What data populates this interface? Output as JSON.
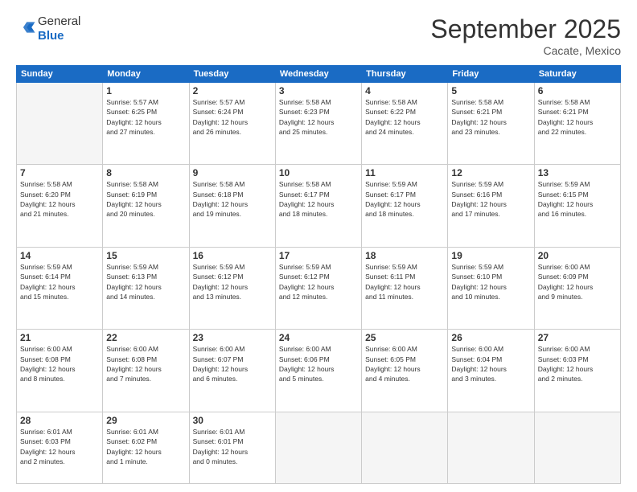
{
  "header": {
    "logo_general": "General",
    "logo_blue": "Blue",
    "month_title": "September 2025",
    "location": "Cacate, Mexico"
  },
  "days_of_week": [
    "Sunday",
    "Monday",
    "Tuesday",
    "Wednesday",
    "Thursday",
    "Friday",
    "Saturday"
  ],
  "weeks": [
    [
      {
        "day": "",
        "info": ""
      },
      {
        "day": "1",
        "info": "Sunrise: 5:57 AM\nSunset: 6:25 PM\nDaylight: 12 hours\nand 27 minutes."
      },
      {
        "day": "2",
        "info": "Sunrise: 5:57 AM\nSunset: 6:24 PM\nDaylight: 12 hours\nand 26 minutes."
      },
      {
        "day": "3",
        "info": "Sunrise: 5:58 AM\nSunset: 6:23 PM\nDaylight: 12 hours\nand 25 minutes."
      },
      {
        "day": "4",
        "info": "Sunrise: 5:58 AM\nSunset: 6:22 PM\nDaylight: 12 hours\nand 24 minutes."
      },
      {
        "day": "5",
        "info": "Sunrise: 5:58 AM\nSunset: 6:21 PM\nDaylight: 12 hours\nand 23 minutes."
      },
      {
        "day": "6",
        "info": "Sunrise: 5:58 AM\nSunset: 6:21 PM\nDaylight: 12 hours\nand 22 minutes."
      }
    ],
    [
      {
        "day": "7",
        "info": "Sunrise: 5:58 AM\nSunset: 6:20 PM\nDaylight: 12 hours\nand 21 minutes."
      },
      {
        "day": "8",
        "info": "Sunrise: 5:58 AM\nSunset: 6:19 PM\nDaylight: 12 hours\nand 20 minutes."
      },
      {
        "day": "9",
        "info": "Sunrise: 5:58 AM\nSunset: 6:18 PM\nDaylight: 12 hours\nand 19 minutes."
      },
      {
        "day": "10",
        "info": "Sunrise: 5:58 AM\nSunset: 6:17 PM\nDaylight: 12 hours\nand 18 minutes."
      },
      {
        "day": "11",
        "info": "Sunrise: 5:59 AM\nSunset: 6:17 PM\nDaylight: 12 hours\nand 18 minutes."
      },
      {
        "day": "12",
        "info": "Sunrise: 5:59 AM\nSunset: 6:16 PM\nDaylight: 12 hours\nand 17 minutes."
      },
      {
        "day": "13",
        "info": "Sunrise: 5:59 AM\nSunset: 6:15 PM\nDaylight: 12 hours\nand 16 minutes."
      }
    ],
    [
      {
        "day": "14",
        "info": "Sunrise: 5:59 AM\nSunset: 6:14 PM\nDaylight: 12 hours\nand 15 minutes."
      },
      {
        "day": "15",
        "info": "Sunrise: 5:59 AM\nSunset: 6:13 PM\nDaylight: 12 hours\nand 14 minutes."
      },
      {
        "day": "16",
        "info": "Sunrise: 5:59 AM\nSunset: 6:12 PM\nDaylight: 12 hours\nand 13 minutes."
      },
      {
        "day": "17",
        "info": "Sunrise: 5:59 AM\nSunset: 6:12 PM\nDaylight: 12 hours\nand 12 minutes."
      },
      {
        "day": "18",
        "info": "Sunrise: 5:59 AM\nSunset: 6:11 PM\nDaylight: 12 hours\nand 11 minutes."
      },
      {
        "day": "19",
        "info": "Sunrise: 5:59 AM\nSunset: 6:10 PM\nDaylight: 12 hours\nand 10 minutes."
      },
      {
        "day": "20",
        "info": "Sunrise: 6:00 AM\nSunset: 6:09 PM\nDaylight: 12 hours\nand 9 minutes."
      }
    ],
    [
      {
        "day": "21",
        "info": "Sunrise: 6:00 AM\nSunset: 6:08 PM\nDaylight: 12 hours\nand 8 minutes."
      },
      {
        "day": "22",
        "info": "Sunrise: 6:00 AM\nSunset: 6:08 PM\nDaylight: 12 hours\nand 7 minutes."
      },
      {
        "day": "23",
        "info": "Sunrise: 6:00 AM\nSunset: 6:07 PM\nDaylight: 12 hours\nand 6 minutes."
      },
      {
        "day": "24",
        "info": "Sunrise: 6:00 AM\nSunset: 6:06 PM\nDaylight: 12 hours\nand 5 minutes."
      },
      {
        "day": "25",
        "info": "Sunrise: 6:00 AM\nSunset: 6:05 PM\nDaylight: 12 hours\nand 4 minutes."
      },
      {
        "day": "26",
        "info": "Sunrise: 6:00 AM\nSunset: 6:04 PM\nDaylight: 12 hours\nand 3 minutes."
      },
      {
        "day": "27",
        "info": "Sunrise: 6:00 AM\nSunset: 6:03 PM\nDaylight: 12 hours\nand 2 minutes."
      }
    ],
    [
      {
        "day": "28",
        "info": "Sunrise: 6:01 AM\nSunset: 6:03 PM\nDaylight: 12 hours\nand 2 minutes."
      },
      {
        "day": "29",
        "info": "Sunrise: 6:01 AM\nSunset: 6:02 PM\nDaylight: 12 hours\nand 1 minute."
      },
      {
        "day": "30",
        "info": "Sunrise: 6:01 AM\nSunset: 6:01 PM\nDaylight: 12 hours\nand 0 minutes."
      },
      {
        "day": "",
        "info": ""
      },
      {
        "day": "",
        "info": ""
      },
      {
        "day": "",
        "info": ""
      },
      {
        "day": "",
        "info": ""
      }
    ]
  ]
}
